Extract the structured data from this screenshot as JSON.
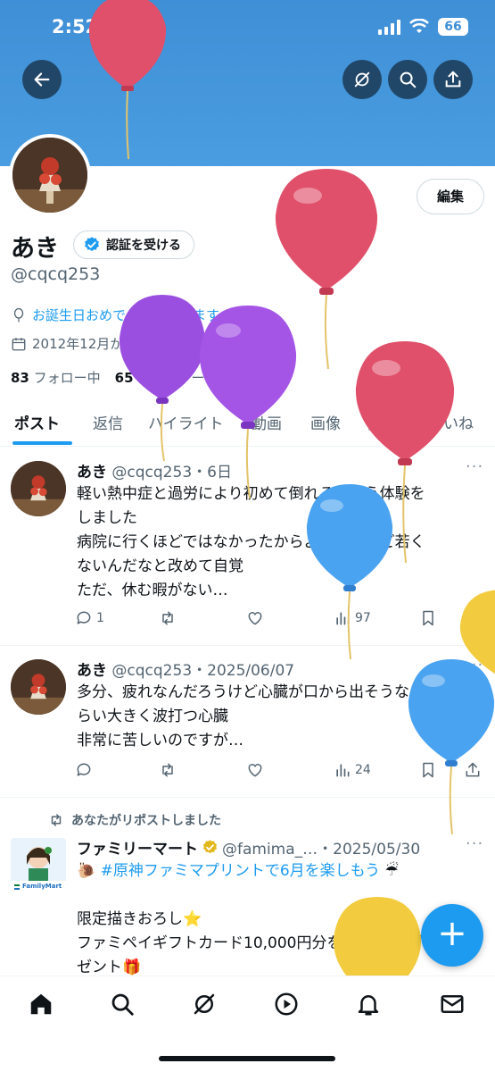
{
  "status_bar": {
    "time": "2:52",
    "battery": "66"
  },
  "profile": {
    "name": "あき",
    "verify_label": "認証を受ける",
    "handle": "@cqcq253",
    "edit_label": "編集",
    "birthday_text": "お誕生日おめでとうございます。",
    "joined_text": "2012年12月からXを利用しています",
    "following_count": "83",
    "following_label": "フォロー中",
    "followers_count": "65",
    "followers_label": "フォロワー"
  },
  "tabs": [
    "ポスト",
    "返信",
    "ハイライト",
    "動画",
    "画像",
    "記事",
    "いいね"
  ],
  "posts": [
    {
      "author": "あき",
      "handle_time": "@cqcq253・6日",
      "lines": [
        "軽い熱中症と過労により初めて倒れると言う体験を",
        "しました",
        "病院に行くほどではなかったからよかったけど若く",
        "ないんだなと改めて自覚",
        "ただ、休む暇がない…"
      ],
      "replies": "1",
      "views": "97"
    },
    {
      "author": "あき",
      "handle_time": "@cqcq253・2025/06/07",
      "lines": [
        "多分、疲れなんだろうけど心臓が口から出そうなく",
        "らい大きく波打つ心臓",
        "非常に苦しいのですが…"
      ],
      "views": "24"
    },
    {
      "repost_label": "あなたがリポストしました",
      "author": "ファミリーマート",
      "handle_time": "@famima_…・2025/05/30",
      "avatar_text": "FamilyMart",
      "hashtag_line": "#原神ファミマプリントで6月を楽しもう",
      "lines": [
        "限定描きおろし⭐",
        "ファミペイギフトカード10,000円分を10名様にプレ",
        "ゼント🎁"
      ]
    }
  ],
  "fab_label": "+",
  "icons": [
    "back-arrow-icon",
    "grok-icon",
    "search-icon",
    "share-icon",
    "home-icon",
    "explore-icon",
    "video-icon",
    "bell-icon",
    "mail-icon"
  ]
}
